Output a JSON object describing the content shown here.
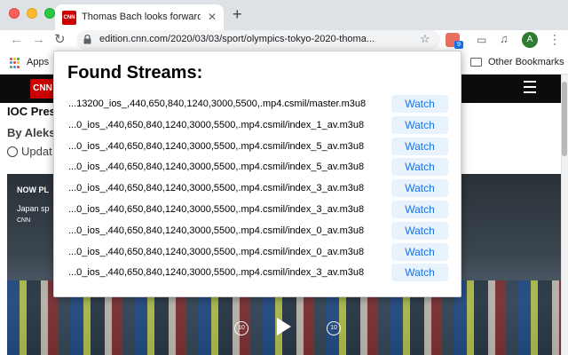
{
  "browser": {
    "tab": {
      "favicon_text": "CNN",
      "title": "Thomas Bach looks forward to",
      "close_glyph": "✕"
    },
    "new_tab_glyph": "+",
    "toolbar": {
      "back_glyph": "←",
      "forward_glyph": "→",
      "reload_glyph": "↻",
      "url": "edition.cnn.com/2020/03/03/sport/olympics-tokyo-2020-thoma...",
      "star_glyph": "☆",
      "extension_badge": "9",
      "cast_glyph": "▭",
      "media_glyph": "♫",
      "profile_initial": "A",
      "menu_glyph": "⋮"
    },
    "bookmarks": {
      "apps_label": "Apps",
      "other_label": "Other Bookmarks"
    }
  },
  "page": {
    "logo_text": "CNN",
    "headline": "IOC Pres",
    "byline": "By Aleks",
    "updated": "Updat",
    "video": {
      "now_playing": "NOW PL",
      "caption": "Japan sp",
      "source": "CNN",
      "rewind_label": "10",
      "forward_label": "10"
    }
  },
  "popup": {
    "title": "Found Streams:",
    "watch_label": "Watch",
    "streams": [
      "...13200_ios_,440,650,840,1240,3000,5500,.mp4.csmil/master.m3u8",
      "...0_ios_,440,650,840,1240,3000,5500,.mp4.csmil/index_1_av.m3u8",
      "...0_ios_,440,650,840,1240,3000,5500,.mp4.csmil/index_5_av.m3u8",
      "...0_ios_,440,650,840,1240,3000,5500,.mp4.csmil/index_5_av.m3u8",
      "...0_ios_,440,650,840,1240,3000,5500,.mp4.csmil/index_3_av.m3u8",
      "...0_ios_,440,650,840,1240,3000,5500,.mp4.csmil/index_3_av.m3u8",
      "...0_ios_,440,650,840,1240,3000,5500,.mp4.csmil/index_0_av.m3u8",
      "...0_ios_,440,650,840,1240,3000,5500,.mp4.csmil/index_0_av.m3u8",
      "...0_ios_,440,650,840,1240,3000,5500,.mp4.csmil/index_3_av.m3u8"
    ]
  },
  "colors": {
    "cnn_red": "#cc0000",
    "watch_text": "#1a73e8",
    "watch_bg": "#e8f2fc"
  }
}
